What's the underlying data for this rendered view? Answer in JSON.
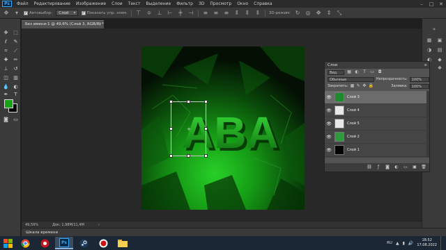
{
  "app": {
    "logo": "Ps",
    "menu": [
      "Файл",
      "Редактирование",
      "Изображение",
      "Слои",
      "Текст",
      "Выделение",
      "Фильтр",
      "3D",
      "Просмотр",
      "Окно",
      "Справка"
    ]
  },
  "window_controls": [
    "minimize-icon",
    "maximize-icon",
    "close-icon"
  ],
  "options": {
    "auto_select_label": "Автовыбор:",
    "auto_select_value": "Слой",
    "show_transform_label": "Показать упр. элем.",
    "mode_3d_label": "3D-режим:"
  },
  "document": {
    "tab_title": "Без имени-1 @ 49,6% (Слой 3, RGB/8) *",
    "close": "×"
  },
  "artwork": {
    "text": "ABA",
    "colors": {
      "green": "#1fb81f",
      "dark": "#041004"
    }
  },
  "colors": {
    "foreground": "#18a018",
    "background": "#000000"
  },
  "status": {
    "zoom": "49,59%",
    "doc_size": "Док: 1,98M/11,4M",
    "arrow": "›"
  },
  "timeline_label": "Шкала времени",
  "layers_panel": {
    "title": "Слои",
    "filter_placeholder": "Вид",
    "blend_mode": "Обычные",
    "opacity_label": "Непрозрачность:",
    "opacity_value": "100%",
    "lock_label": "Закрепить:",
    "fill_label": "Заливка:",
    "fill_value": "100%",
    "layers": [
      {
        "name": "Слой 3",
        "selected": true,
        "thumb": "#1f8a2b"
      },
      {
        "name": "Слой 4",
        "selected": false,
        "thumb": "#e8e8e8"
      },
      {
        "name": "Слой 5",
        "selected": false,
        "thumb": "#e8e8e8"
      },
      {
        "name": "Слой 2",
        "selected": false,
        "thumb": "#2e9a3c"
      },
      {
        "name": "Слой 1",
        "selected": false,
        "thumb": "#000000"
      }
    ],
    "footer_icons": [
      "link-icon",
      "fx-icon",
      "mask-icon",
      "adjustment-icon",
      "group-icon",
      "new-layer-icon",
      "trash-icon"
    ]
  },
  "taskbar": {
    "apps": [
      "chrome-icon",
      "media-player-icon",
      "photoshop-icon",
      "steam-icon",
      "record-icon",
      "file-explorer-icon"
    ],
    "active_app": "Ps",
    "lang": "RU",
    "time": "18:52",
    "date": "17.08.2022"
  }
}
